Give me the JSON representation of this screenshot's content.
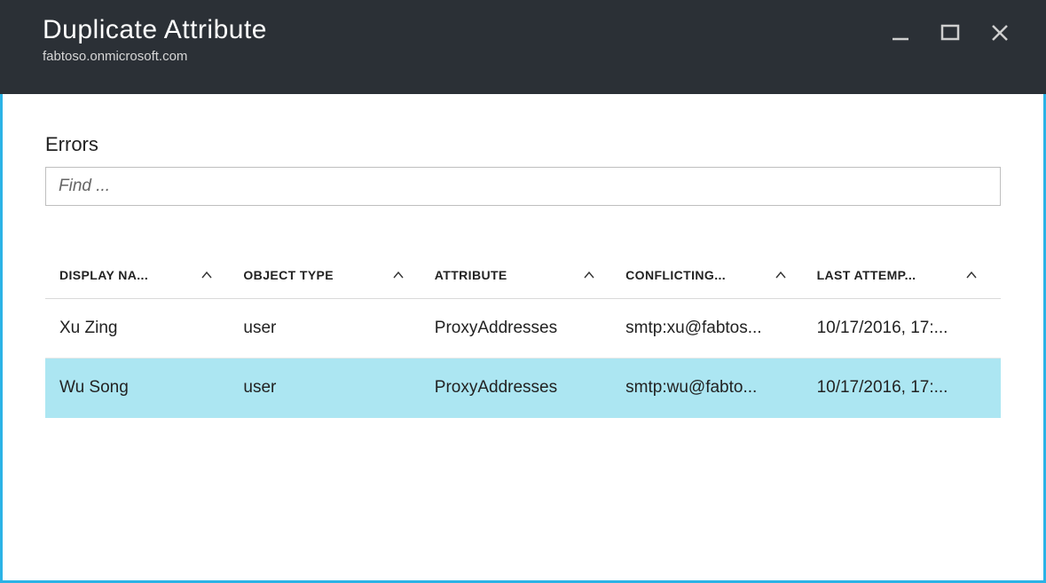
{
  "header": {
    "title": "Duplicate Attribute",
    "subtitle": "fabtoso.onmicrosoft.com"
  },
  "section": {
    "title": "Errors",
    "search_placeholder": "Find ..."
  },
  "table": {
    "columns": [
      {
        "label": "DISPLAY NA..."
      },
      {
        "label": "OBJECT TYPE"
      },
      {
        "label": "ATTRIBUTE"
      },
      {
        "label": "CONFLICTING..."
      },
      {
        "label": "LAST ATTEMP..."
      }
    ],
    "rows": [
      {
        "display_name": "Xu Zing",
        "object_type": "user",
        "attribute": "ProxyAddresses",
        "conflicting": "smtp:xu@fabtos...",
        "last_attempt": "10/17/2016, 17:...",
        "selected": false
      },
      {
        "display_name": "Wu Song",
        "object_type": "user",
        "attribute": "ProxyAddresses",
        "conflicting": "smtp:wu@fabto...",
        "last_attempt": "10/17/2016, 17:...",
        "selected": true
      }
    ]
  }
}
